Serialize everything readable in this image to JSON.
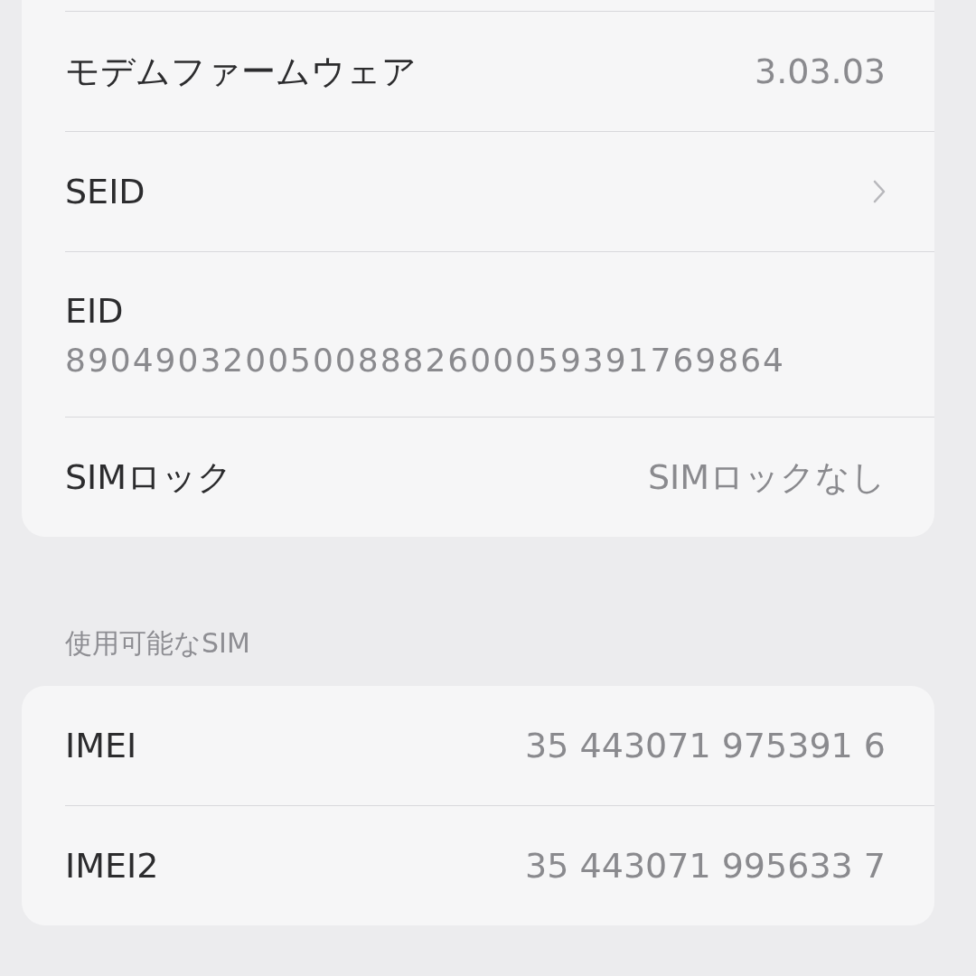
{
  "sections": [
    {
      "rows": [
        {
          "kind": "value",
          "label": "モデムファームウェア",
          "value": "3.03.03"
        },
        {
          "kind": "link",
          "label": "SEID"
        },
        {
          "kind": "stacked",
          "label": "EID",
          "value": "89049032005008882600059391769864"
        },
        {
          "kind": "value",
          "label": "SIMロック",
          "value": "SIMロックなし"
        }
      ]
    },
    {
      "header": "使用可能なSIM",
      "rows": [
        {
          "kind": "value",
          "label": "IMEI",
          "value": "35 443071 975391 6"
        },
        {
          "kind": "value",
          "label": "IMEI2",
          "value": "35 443071 995633 7"
        }
      ]
    }
  ]
}
